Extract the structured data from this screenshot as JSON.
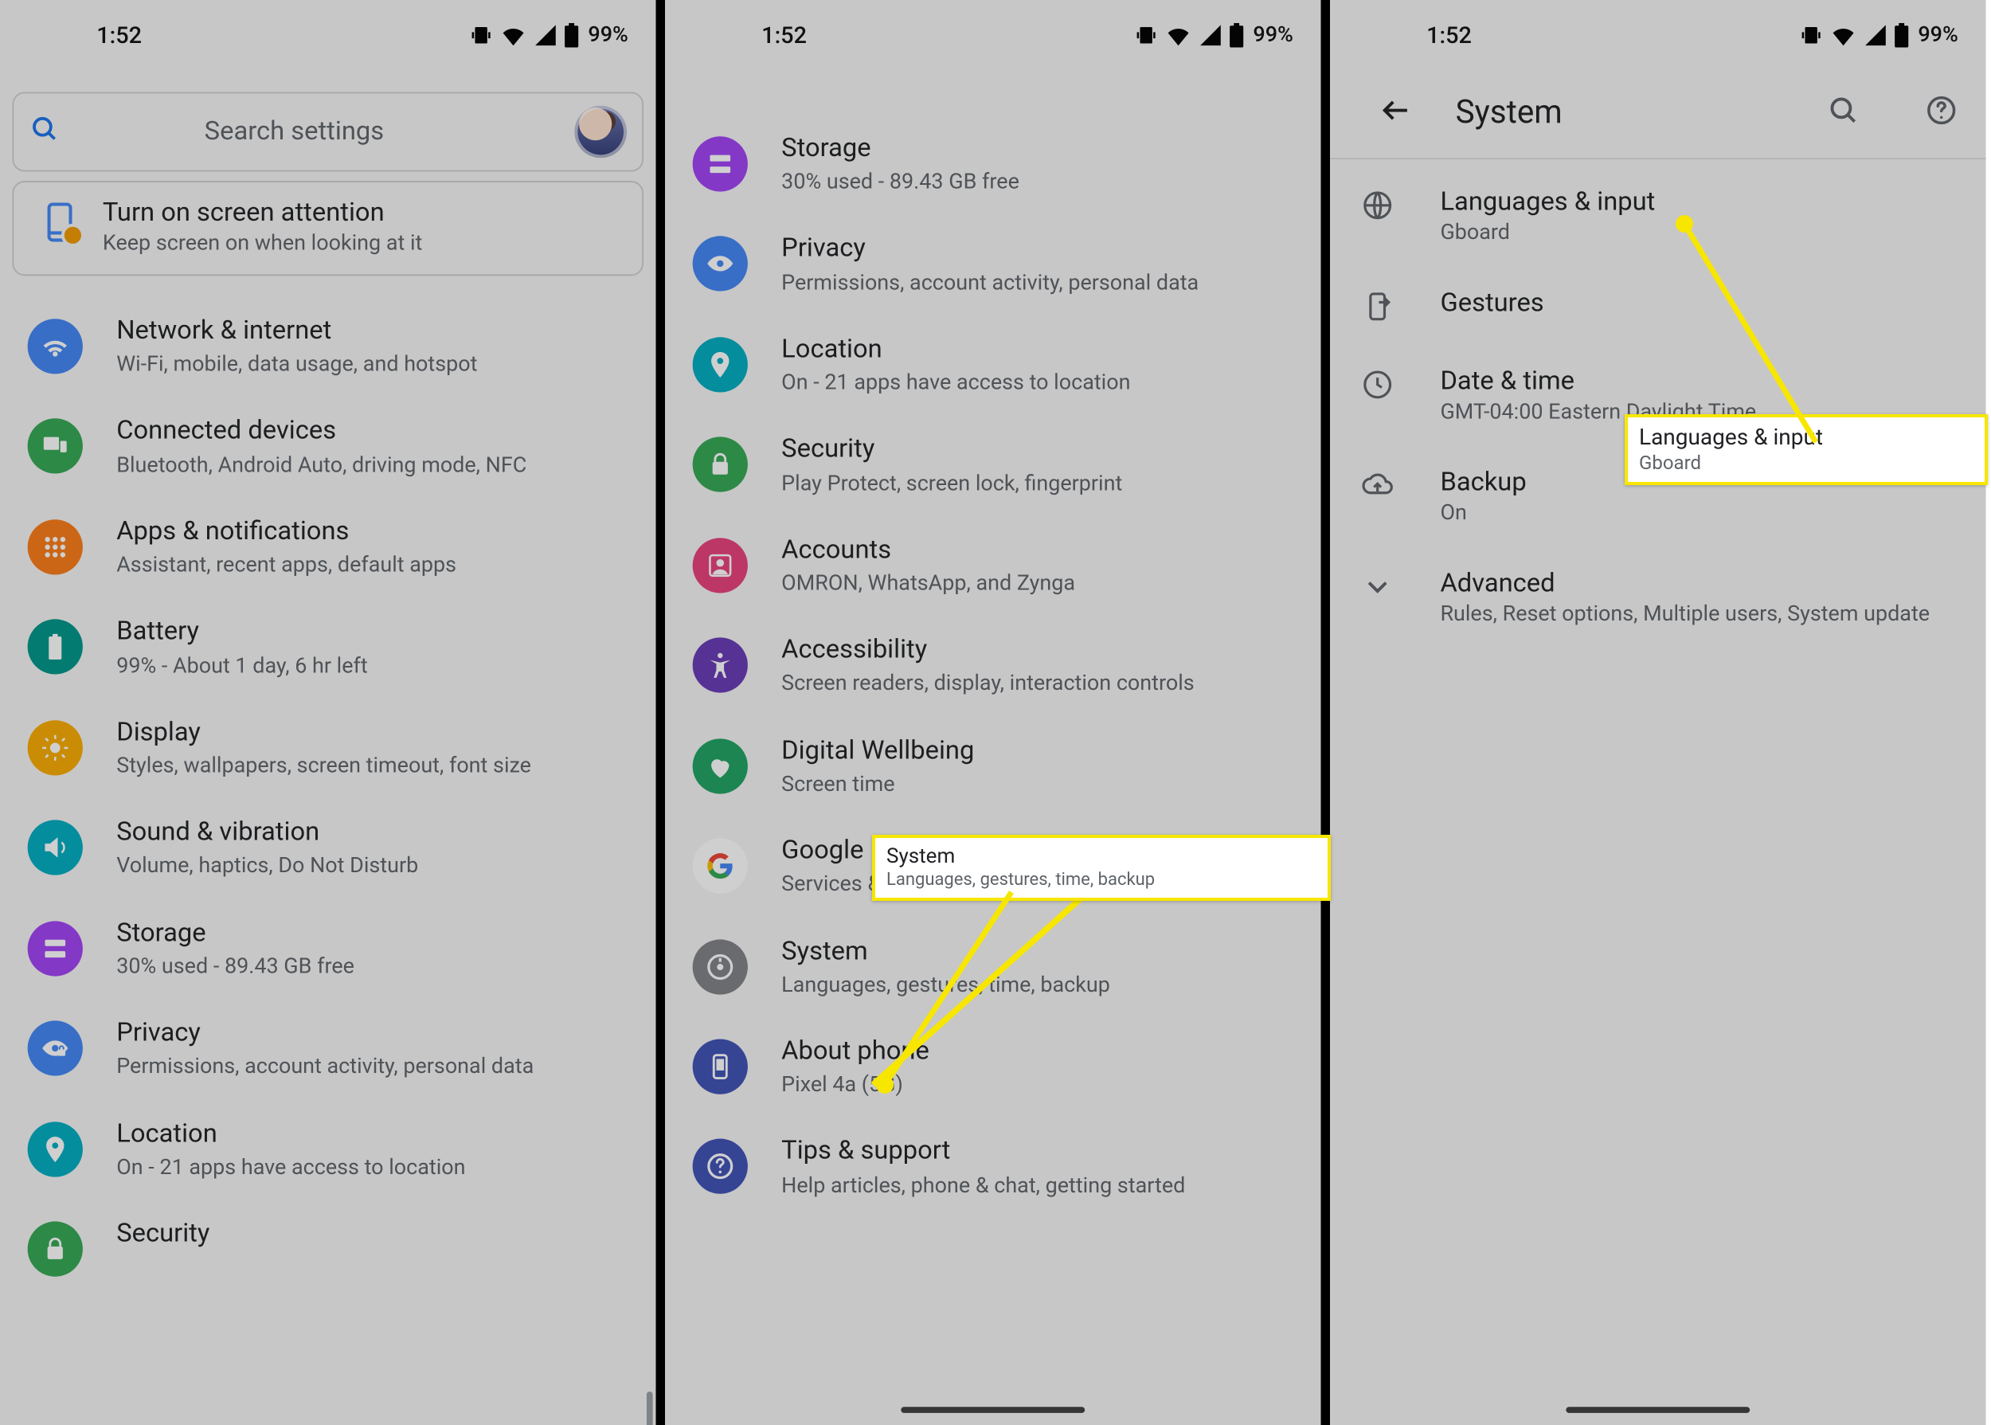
{
  "status": {
    "time": "1:52",
    "battery": "99%"
  },
  "panel1": {
    "search_placeholder": "Search settings",
    "card": {
      "title": "Turn on screen attention",
      "sub": "Keep screen on when looking at it"
    },
    "items": [
      {
        "title": "Network & internet",
        "sub": "Wi-Fi, mobile, data usage, and hotspot"
      },
      {
        "title": "Connected devices",
        "sub": "Bluetooth, Android Auto, driving mode, NFC"
      },
      {
        "title": "Apps & notifications",
        "sub": "Assistant, recent apps, default apps"
      },
      {
        "title": "Battery",
        "sub": "99% - About 1 day, 6 hr left"
      },
      {
        "title": "Display",
        "sub": "Styles, wallpapers, screen timeout, font size"
      },
      {
        "title": "Sound & vibration",
        "sub": "Volume, haptics, Do Not Disturb"
      },
      {
        "title": "Storage",
        "sub": "30% used - 89.43 GB free"
      },
      {
        "title": "Privacy",
        "sub": "Permissions, account activity, personal data"
      },
      {
        "title": "Location",
        "sub": "On - 21 apps have access to location"
      },
      {
        "title": "Security",
        "sub": ""
      }
    ]
  },
  "panel2": {
    "items": [
      {
        "title": "Storage",
        "sub": "30% used - 89.43 GB free"
      },
      {
        "title": "Privacy",
        "sub": "Permissions, account activity, personal data"
      },
      {
        "title": "Location",
        "sub": "On - 21 apps have access to location"
      },
      {
        "title": "Security",
        "sub": "Play Protect, screen lock, fingerprint"
      },
      {
        "title": "Accounts",
        "sub": "OMRON, WhatsApp, and Zynga"
      },
      {
        "title": "Accessibility",
        "sub": "Screen readers, display, interaction controls"
      },
      {
        "title": "Digital Wellbeing",
        "sub": "Screen time"
      },
      {
        "title": "Google",
        "sub": "Services & preferences"
      },
      {
        "title": "System",
        "sub": "Languages, gestures, time, backup"
      },
      {
        "title": "About phone",
        "sub": "Pixel 4a (5G)"
      },
      {
        "title": "Tips & support",
        "sub": "Help articles, phone & chat, getting started"
      }
    ]
  },
  "panel3": {
    "header": "System",
    "items": [
      {
        "title": "Languages & input",
        "sub": "Gboard"
      },
      {
        "title": "Gestures",
        "sub": ""
      },
      {
        "title": "Date & time",
        "sub": "GMT-04:00 Eastern Daylight Time"
      },
      {
        "title": "Backup",
        "sub": "On"
      },
      {
        "title": "Advanced",
        "sub": "Rules, Reset options, Multiple users, System update"
      }
    ]
  },
  "callouts": {
    "system": {
      "title": "System",
      "sub": "Languages, gestures, time, backup"
    },
    "langinput": {
      "title": "Languages & input",
      "sub": "Gboard"
    }
  }
}
